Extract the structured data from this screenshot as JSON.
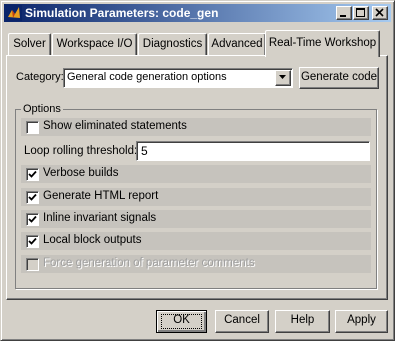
{
  "window": {
    "title": "Simulation Parameters: code_gen",
    "controls": [
      "minimize-icon",
      "maximize-icon",
      "close-icon"
    ]
  },
  "tabs": [
    {
      "label": "Solver",
      "active": false
    },
    {
      "label": "Workspace I/O",
      "active": false
    },
    {
      "label": "Diagnostics",
      "active": false
    },
    {
      "label": "Advanced",
      "active": false
    },
    {
      "label": "Real-Time Workshop",
      "active": true
    }
  ],
  "category": {
    "label": "Category:",
    "selected": "General code generation options",
    "generate_button": "Generate code"
  },
  "options": {
    "title": "Options",
    "show_eliminated": {
      "label": "Show eliminated statements",
      "checked": false
    },
    "loop_rolling": {
      "label": "Loop rolling threshold:",
      "value": "5"
    },
    "verbose_builds": {
      "label": "Verbose builds",
      "checked": true
    },
    "html_report": {
      "label": "Generate HTML report",
      "checked": true
    },
    "inline_invariant": {
      "label": "Inline invariant signals",
      "checked": true
    },
    "local_block": {
      "label": "Local block outputs",
      "checked": true
    },
    "force_comments": {
      "label": "Force generation of parameter comments",
      "checked": false,
      "enabled": false
    }
  },
  "buttons": {
    "ok": "OK",
    "cancel": "Cancel",
    "help": "Help",
    "apply": "Apply"
  },
  "colors": {
    "title_start": "#0a246a",
    "title_end": "#a6caf0",
    "face": "#d4d0c8",
    "row_band": "#c6c3bd"
  }
}
